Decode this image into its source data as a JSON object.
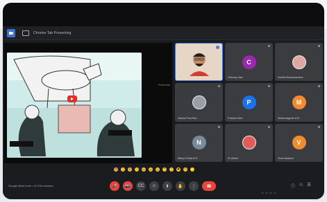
{
  "window": {
    "tab_title": "Chrome Tab Presenting"
  },
  "presentation": {
    "header_left": "",
    "presenter_label": "Presenter",
    "slide_text_left": "COOFOLKS",
    "slide_text_right": "COOFOLKS"
  },
  "participants": [
    {
      "name": "You",
      "initial": "",
      "color": "#4b7be5",
      "kind": "video"
    },
    {
      "name": "Chinmay Sam",
      "initial": "C",
      "color": "#9c27b0",
      "kind": "avatar"
    },
    {
      "name": "Kavitha Ramachandran",
      "initial": "",
      "color": "#e0a7a0",
      "kind": "photo"
    },
    {
      "name": "Harsha Praa Ravi",
      "initial": "",
      "color": "#9aa0a6",
      "kind": "photo"
    },
    {
      "name": "Prakash Mani",
      "initial": "P",
      "color": "#1a73e8",
      "kind": "avatar"
    },
    {
      "name": "Madhanagavan A M",
      "initial": "M",
      "color": "#f28b30",
      "kind": "avatar"
    },
    {
      "name": "Nithya & Bala M R",
      "initial": "N",
      "color": "#7a8a9a",
      "kind": "avatar"
    },
    {
      "name": "Sri Aldaro",
      "initial": "",
      "color": "#e25c5c",
      "kind": "logo"
    },
    {
      "name": "Vimal Asaitami",
      "initial": "V",
      "color": "#f28b30",
      "kind": "avatar"
    }
  ],
  "meeting": {
    "info": "Google Meet room • 1h 20m session"
  },
  "controls": [
    {
      "name": "mic-off-button",
      "icon": "🎤",
      "state": "off"
    },
    {
      "name": "camera-off-button",
      "icon": "📷",
      "state": "off"
    },
    {
      "name": "captions-button",
      "icon": "CC",
      "state": "on"
    },
    {
      "name": "reactions-button",
      "icon": "☺",
      "state": "on"
    },
    {
      "name": "present-button",
      "icon": "⬆",
      "state": "on"
    },
    {
      "name": "raise-hand-button",
      "icon": "✋",
      "state": "on"
    },
    {
      "name": "more-options-button",
      "icon": "⋮",
      "state": "on"
    },
    {
      "name": "end-call-button",
      "icon": "☎",
      "state": "end"
    }
  ],
  "right_icons": [
    "ⓘ",
    "⚇",
    "☰"
  ],
  "reactions": [
    "💖",
    "👍",
    "🎉",
    "👏",
    "😂",
    "😮",
    "😢",
    "🤔",
    "👎",
    "❤",
    "🔥",
    "⭐"
  ]
}
